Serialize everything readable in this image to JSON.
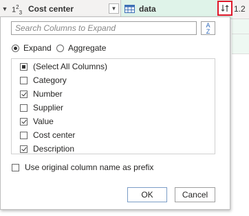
{
  "header": {
    "col1": {
      "type": "1²₃",
      "name": "Cost center"
    },
    "col2": {
      "name": "data",
      "icon": "table-icon"
    },
    "col3": {
      "type": "1.2"
    }
  },
  "panel": {
    "search_placeholder": "Search Columns to Expand",
    "mode": {
      "expand_label": "Expand",
      "aggregate_label": "Aggregate",
      "selected": "Expand"
    },
    "columns": [
      {
        "label": "(Select All Columns)",
        "state": "partial"
      },
      {
        "label": "Category",
        "state": "unchecked"
      },
      {
        "label": "Number",
        "state": "checked"
      },
      {
        "label": "Supplier",
        "state": "unchecked"
      },
      {
        "label": "Value",
        "state": "checked"
      },
      {
        "label": "Cost center",
        "state": "unchecked"
      },
      {
        "label": "Description",
        "state": "checked"
      }
    ],
    "prefix_label": "Use original column name as prefix",
    "prefix_checked": false,
    "ok_label": "OK",
    "cancel_label": "Cancel"
  },
  "colors": {
    "accent_highlight": "#e0172a",
    "selected_column": "#dff3e9"
  }
}
